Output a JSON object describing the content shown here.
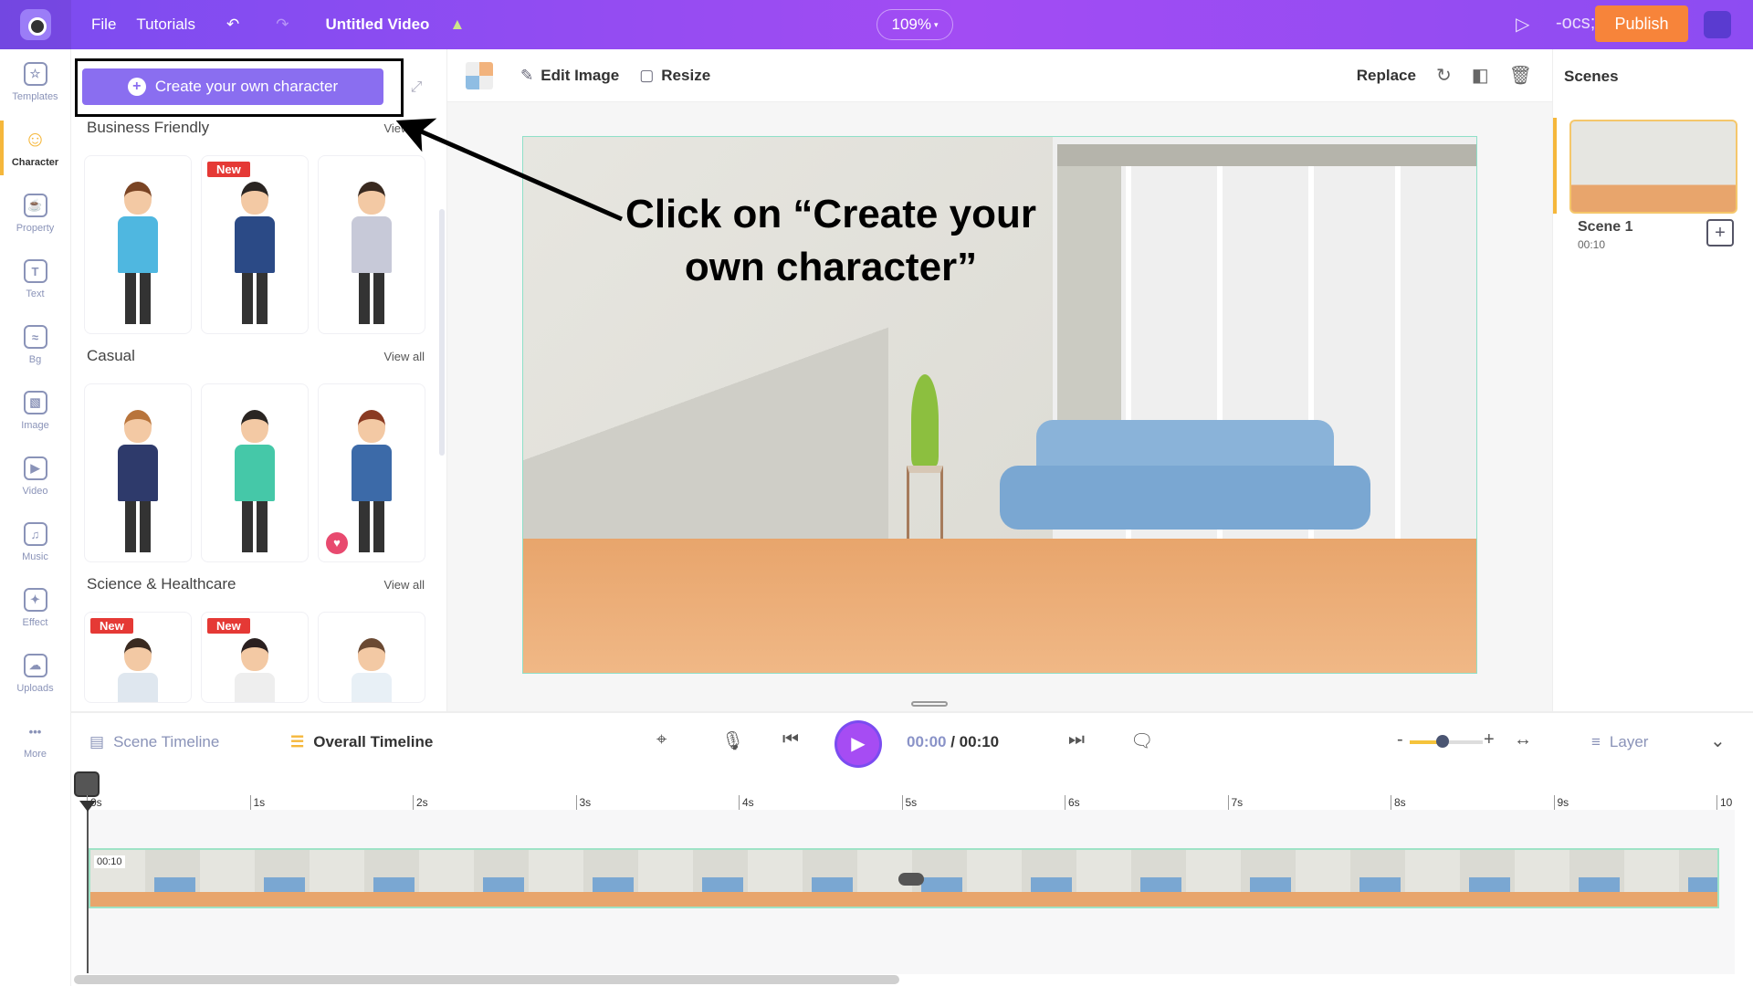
{
  "topbar": {
    "menu": [
      "File",
      "Tutorials"
    ],
    "title": "Untitled Video",
    "zoom": "109%",
    "publish": "Publish"
  },
  "rail": [
    {
      "label": "Templates",
      "icon": "templates-icon"
    },
    {
      "label": "Character",
      "icon": "character-icon",
      "active": true
    },
    {
      "label": "Property",
      "icon": "property-icon"
    },
    {
      "label": "Text",
      "icon": "text-icon"
    },
    {
      "label": "Bg",
      "icon": "background-icon"
    },
    {
      "label": "Image",
      "icon": "image-icon"
    },
    {
      "label": "Video",
      "icon": "video-icon"
    },
    {
      "label": "Music",
      "icon": "music-icon"
    },
    {
      "label": "Effect",
      "icon": "effect-icon"
    },
    {
      "label": "Uploads",
      "icon": "uploads-icon"
    },
    {
      "label": "More",
      "icon": "more-icon"
    }
  ],
  "panel": {
    "create_button": "Create your own character",
    "sections": [
      {
        "title": "Business Friendly",
        "view_all": "View all",
        "badges": [
          "",
          "New",
          ""
        ]
      },
      {
        "title": "Casual",
        "view_all": "View all",
        "badges": [
          "",
          "",
          ""
        ]
      },
      {
        "title": "Science & Healthcare",
        "view_all": "View all",
        "badges": [
          "New",
          "New",
          ""
        ]
      }
    ]
  },
  "toolbar": {
    "edit_image": "Edit Image",
    "resize": "Resize",
    "replace": "Replace"
  },
  "annotation": {
    "line1": "Click on “Create your",
    "line2": "own character”"
  },
  "scenes": {
    "title": "Scenes",
    "items": [
      {
        "name": "Scene 1",
        "duration": "00:10"
      }
    ]
  },
  "timeline": {
    "scene_tab": "Scene Timeline",
    "overall_tab": "Overall Timeline",
    "current": "00:00",
    "separator": " / ",
    "total": "00:10",
    "layer": "Layer",
    "zoom_level": 0.45,
    "ticks": [
      "0s",
      "1s",
      "2s",
      "3s",
      "4s",
      "5s",
      "6s",
      "7s",
      "8s",
      "9s",
      "10"
    ],
    "clip_duration": "00:10"
  },
  "colors": {
    "brand": "#8d4cf2",
    "publish": "#f7843a",
    "accent": "#f5b73b",
    "new_badge": "#e53935"
  }
}
